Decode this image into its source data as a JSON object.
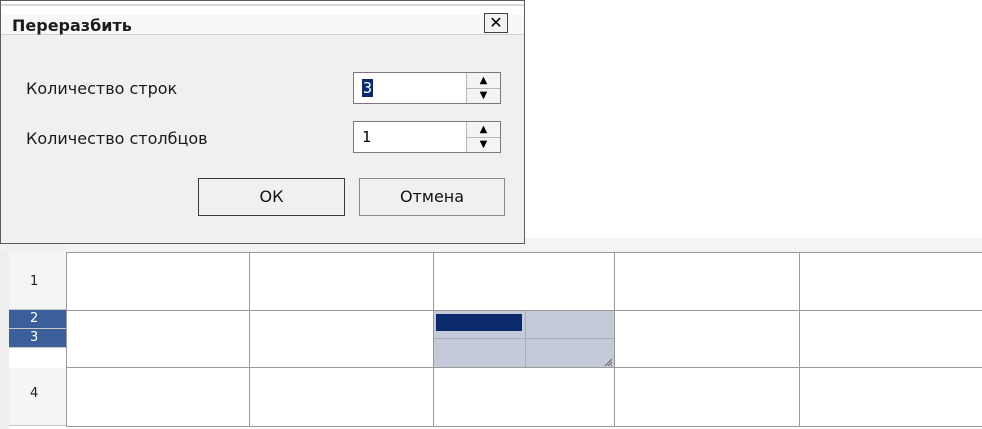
{
  "dialog": {
    "title": "Переразбить",
    "close_symbol": "✕",
    "rows_label": "Количество строк",
    "rows_value": "3",
    "cols_label": "Количество столбцов",
    "cols_value": "1",
    "ok_label": "ОК",
    "cancel_label": "Отмена",
    "spin_up": "▲",
    "spin_down": "▼"
  },
  "grid": {
    "row_labels": [
      "1",
      "2",
      "3",
      "4"
    ],
    "selection_color": "#c5cad9",
    "highlight_color": "#0b2a6b"
  },
  "icons": [
    "close-icon",
    "spin-up-icon",
    "spin-down-icon",
    "resize-grip-icon"
  ]
}
